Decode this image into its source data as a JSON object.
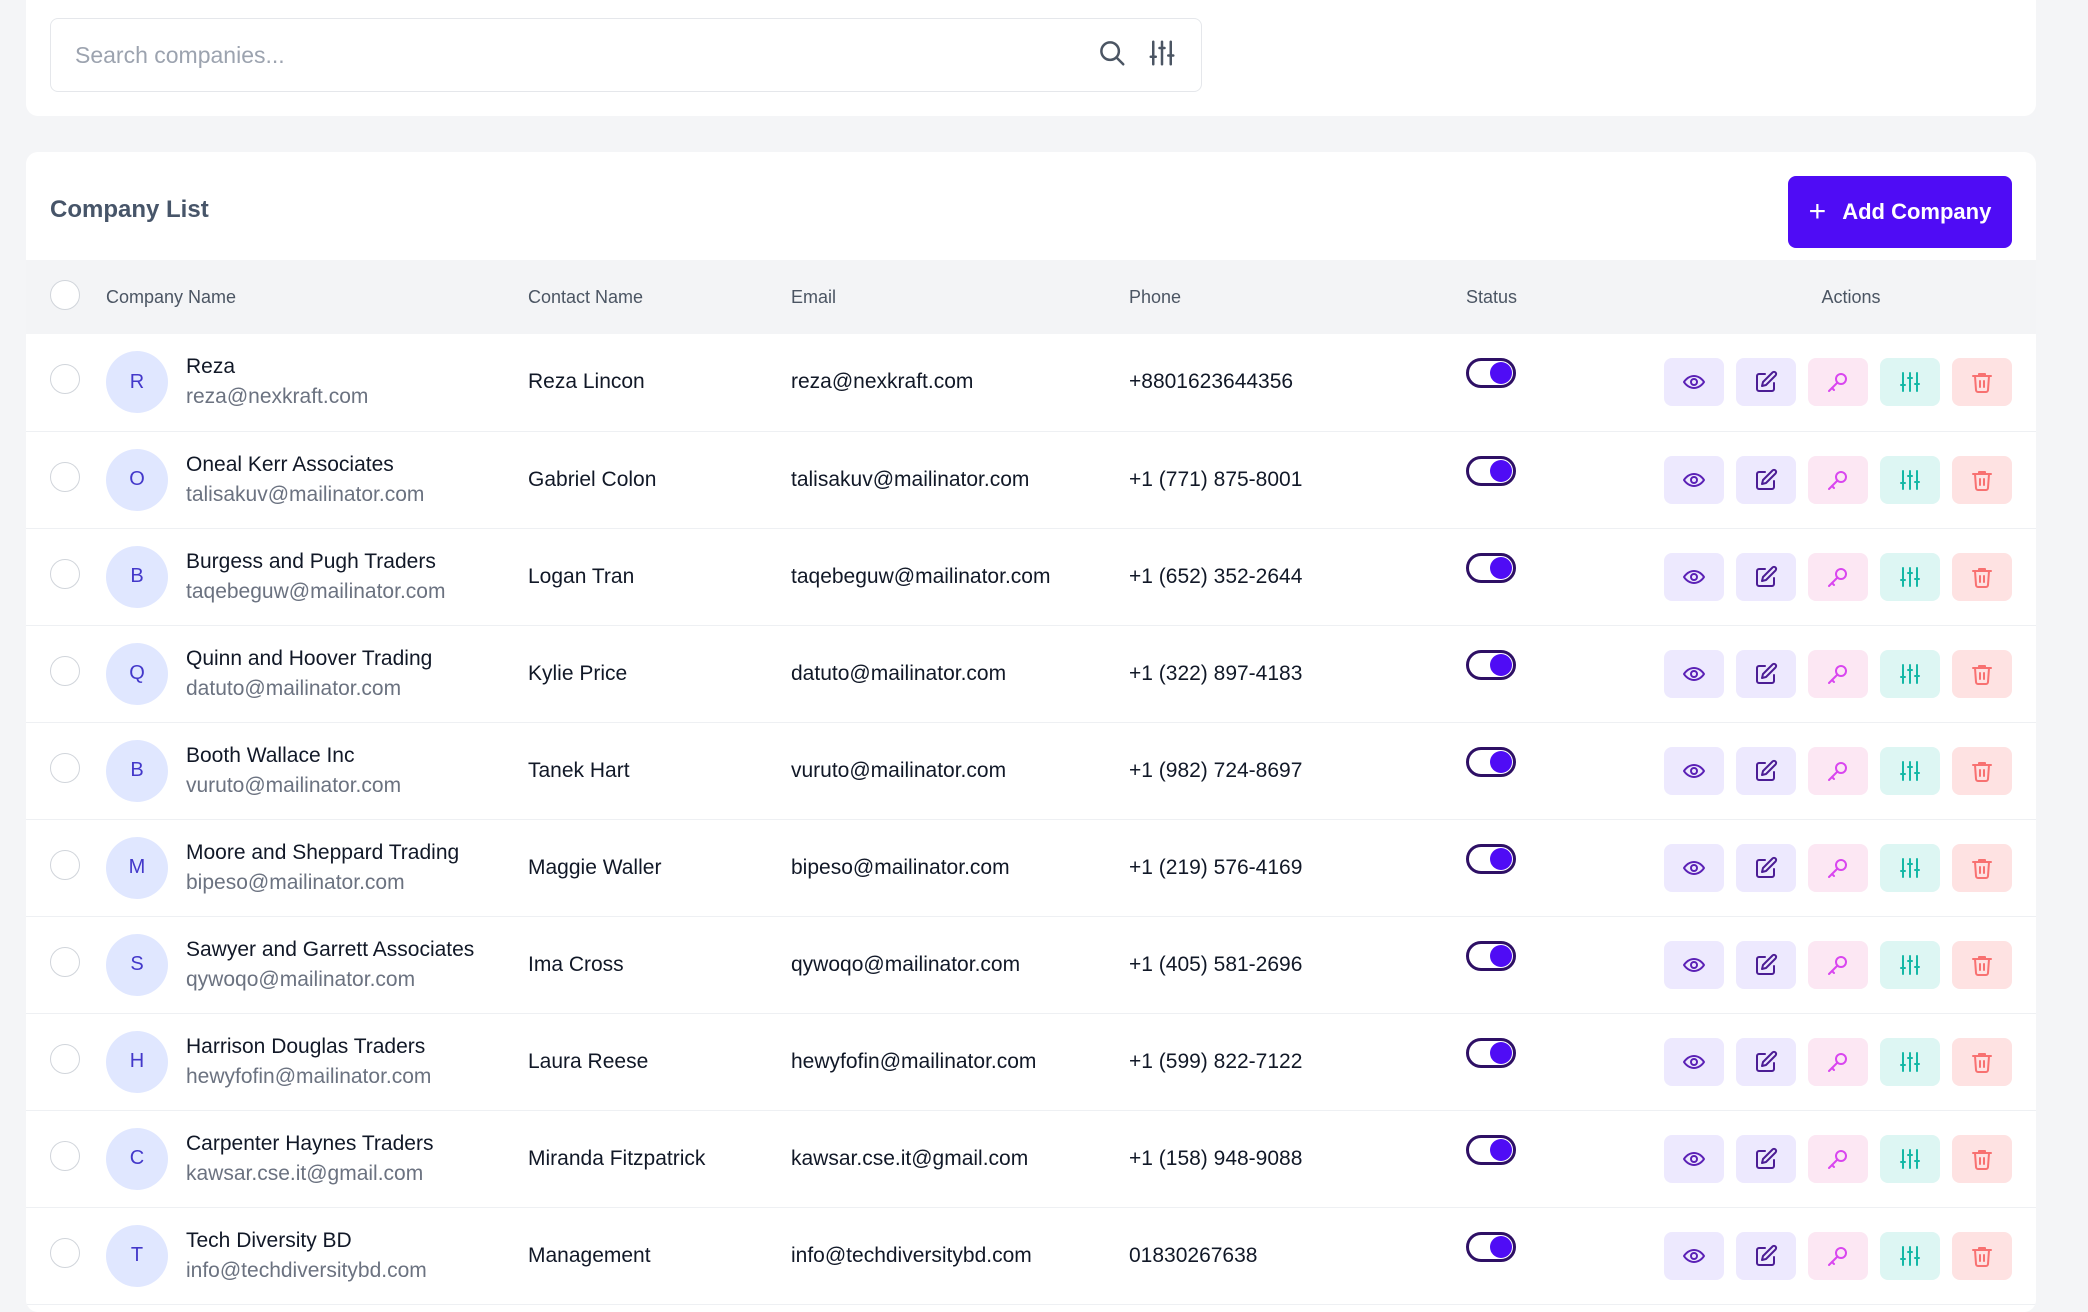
{
  "search": {
    "placeholder": "Search companies...",
    "search_icon": "search-icon",
    "filter_icon": "sliders-icon"
  },
  "list": {
    "title": "Company List",
    "add_button_label": "Add Company",
    "add_button_icon": "plus-icon",
    "accent_color": "#4f0cf5"
  },
  "table": {
    "columns": [
      "Company Name",
      "Contact Name",
      "Email",
      "Phone",
      "Status",
      "Actions"
    ],
    "rows": [
      {
        "initial": "R",
        "company": "Reza",
        "company_email": "reza@nexkraft.com",
        "contact": "Reza Lincon",
        "email": "reza@nexkraft.com",
        "phone": "+8801623644356",
        "status": "active"
      },
      {
        "initial": "O",
        "company": "Oneal Kerr Associates",
        "company_email": "talisakuv@mailinator.com",
        "contact": "Gabriel Colon",
        "email": "talisakuv@mailinator.com",
        "phone": "+1 (771) 875-8001",
        "status": "active"
      },
      {
        "initial": "B",
        "company": "Burgess and Pugh Traders",
        "company_email": "taqebeguw@mailinator.com",
        "contact": "Logan Tran",
        "email": "taqebeguw@mailinator.com",
        "phone": "+1 (652) 352-2644",
        "status": "active"
      },
      {
        "initial": "Q",
        "company": "Quinn and Hoover Trading",
        "company_email": "datuto@mailinator.com",
        "contact": "Kylie Price",
        "email": "datuto@mailinator.com",
        "phone": "+1 (322) 897-4183",
        "status": "active"
      },
      {
        "initial": "B",
        "company": "Booth Wallace Inc",
        "company_email": "vuruto@mailinator.com",
        "contact": "Tanek Hart",
        "email": "vuruto@mailinator.com",
        "phone": "+1 (982) 724-8697",
        "status": "active"
      },
      {
        "initial": "M",
        "company": "Moore and Sheppard Trading",
        "company_email": "bipeso@mailinator.com",
        "contact": "Maggie Waller",
        "email": "bipeso@mailinator.com",
        "phone": "+1 (219) 576-4169",
        "status": "active"
      },
      {
        "initial": "S",
        "company": "Sawyer and Garrett Associates",
        "company_email": "qywoqo@mailinator.com",
        "contact": "Ima Cross",
        "email": "qywoqo@mailinator.com",
        "phone": "+1 (405) 581-2696",
        "status": "active"
      },
      {
        "initial": "H",
        "company": "Harrison Douglas Traders",
        "company_email": "hewyfofin@mailinator.com",
        "contact": "Laura Reese",
        "email": "hewyfofin@mailinator.com",
        "phone": "+1 (599) 822-7122",
        "status": "active"
      },
      {
        "initial": "C",
        "company": "Carpenter Haynes Traders",
        "company_email": "kawsar.cse.it@gmail.com",
        "contact": "Miranda Fitzpatrick",
        "email": "kawsar.cse.it@gmail.com",
        "phone": "+1 (158) 948-9088",
        "status": "active"
      },
      {
        "initial": "T",
        "company": "Tech Diversity BD",
        "company_email": "info@techdiversitybd.com",
        "contact": "Management",
        "email": "info@techdiversitybd.com",
        "phone": "01830267638",
        "status": "active"
      }
    ],
    "row_actions": [
      "eye-icon",
      "edit-icon",
      "key-icon",
      "sliders-icon",
      "trash-icon"
    ]
  }
}
